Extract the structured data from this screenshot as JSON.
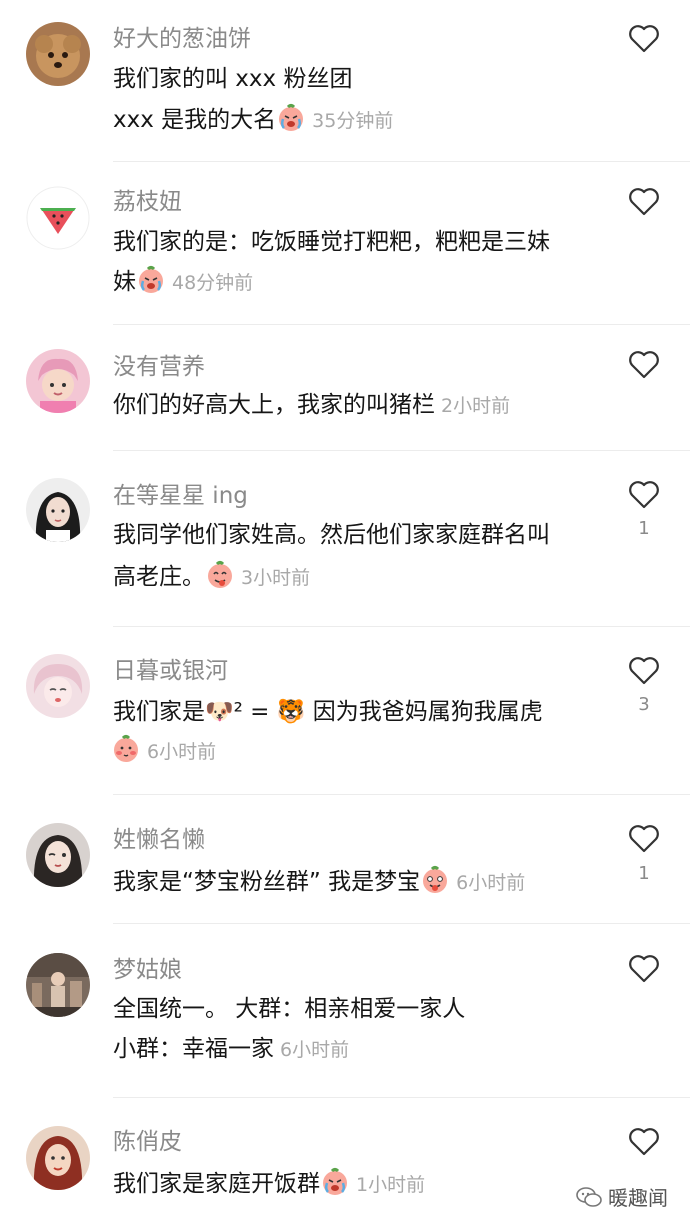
{
  "comments": [
    {
      "username": "好大的葱油饼",
      "lines": [
        "我们家的叫 xxx 粉丝团",
        "xxx 是我的大名"
      ],
      "time": "35分钟前",
      "like_count": "",
      "avatar": "curly-dog-avatar",
      "emoji": "crying-face-emoji"
    },
    {
      "username": "荔枝妞",
      "lines": [
        "我们家的是：吃饭睡觉打粑粑，粑粑是三妹",
        "妹"
      ],
      "time": "48分钟前",
      "like_count": "",
      "avatar": "watermelon-avatar",
      "emoji": "crying-face-emoji"
    },
    {
      "username": "没有营养",
      "lines": [
        "你们的好高大上，我家的叫猪栏"
      ],
      "time": "2小时前",
      "like_count": "",
      "avatar": "pink-hair-person-avatar",
      "emoji": ""
    },
    {
      "username": "在等星星 ing",
      "lines": [
        "我同学他们家姓高。然后他们家家庭群名叫",
        "高老庄。"
      ],
      "time": "3小时前",
      "like_count": "1",
      "avatar": "girl-portrait-avatar",
      "emoji": "tongue-face-emoji"
    },
    {
      "username": "日暮或银河",
      "lines": [
        "我们家是🐶² = 🐯 因为我爸妈属狗我属虎",
        ""
      ],
      "time": "6小时前",
      "like_count": "3",
      "avatar": "anime-girl-avatar",
      "emoji": "shy-face-emoji"
    },
    {
      "username": "姓懒名懒",
      "lines": [
        "我家是“梦宝粉丝群” 我是梦宝"
      ],
      "time": "6小时前",
      "like_count": "1",
      "avatar": "winking-girl-avatar",
      "emoji": "tongue-face-emoji"
    },
    {
      "username": "梦姑娘",
      "lines": [
        "全国统一。   大群：相亲相爱一家人",
        "小群：幸福一家"
      ],
      "time": "6小时前",
      "like_count": "",
      "avatar": "street-photo-avatar",
      "emoji": ""
    },
    {
      "username": "陈俏皮",
      "lines": [
        "我们家是家庭开饭群"
      ],
      "time": "1小时前",
      "like_count": "",
      "avatar": "red-hair-girl-avatar",
      "emoji": "crying-face-emoji"
    }
  ],
  "watermark": {
    "text": "暖趣闻",
    "icon": "wechat-icon"
  }
}
